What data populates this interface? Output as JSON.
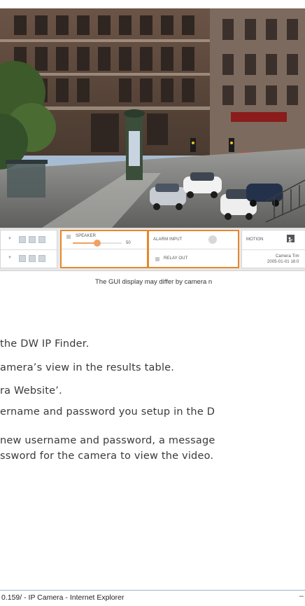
{
  "controls": {
    "speaker_label": "SPEAKER",
    "speaker_value": "50",
    "speaker_level": 0.5,
    "alarm_input_label": "ALARM INPUT",
    "relay_out_label": "RELAY OUT",
    "motion_label": "MOTION",
    "camera_time_label": "Camera Tim",
    "camera_time_value": "2005-01-01 16:0"
  },
  "caption": "The GUI display may differ by camera n",
  "steps": [
    " the DW IP Finder.",
    "amera’s view in the results table.",
    "ra Website’.",
    "ername and password you setup in the D",
    "new username and password, a message",
    "ssword for the camera to view the video."
  ],
  "browser": {
    "title": "0.159/ - IP Camera - Internet Explorer",
    "minimize_glyph": "–"
  },
  "colors": {
    "highlight": "#e8862c",
    "slider_knob": "#f0a060"
  }
}
